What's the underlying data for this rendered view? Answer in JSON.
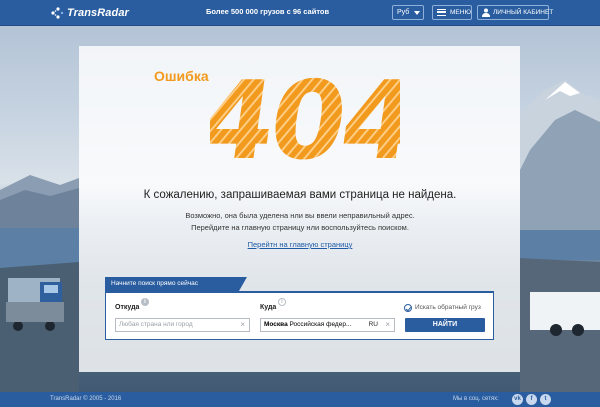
{
  "header": {
    "logo_text": "TransRadar",
    "tagline_prefix": "Более ",
    "tagline_count": "500 000",
    "tagline_mid": " грузов с ",
    "tagline_sites": "96",
    "tagline_suffix": " сайтов",
    "currency": "Руб",
    "menu_label": "МЕНЮ",
    "cabinet_label": "ЛИЧНЫЙ КАБИНЕТ"
  },
  "error": {
    "word": "Ошибка",
    "code": "404",
    "title": "К сожалению, запрашиваемая вами страница не найдена.",
    "line1": "Возможно, она была уделена нли вы ввели неправильный адрес.",
    "line2": "Перейдите на главную страницу нли воспользуйтесь поиском.",
    "home_link": "Перейтн на главную страницу"
  },
  "search": {
    "tab_label": "Начните поиск прямо сейчас",
    "from_label": "Откуда",
    "from_placeholder": "Любая страна нли город",
    "to_label": "Куда",
    "to_value_city": "Москва",
    "to_value_region": " Российская федер...",
    "to_value_code": "RU",
    "reverse_label": "Искать обратный груз",
    "find_button": "НАЙТИ",
    "clear_glyph": "×",
    "info_glyph": "i"
  },
  "footer": {
    "copyright": "TransRadar © 2005 - 2016",
    "social_text": "Мы в соц. сетях:",
    "social_vk": "vk",
    "social_fb": "f",
    "social_tw": "t"
  },
  "colors": {
    "brand_blue": "#2a5d9f",
    "accent_orange": "#f29a1d"
  },
  "icons": {
    "logo": "radar-dots-icon",
    "menu": "hamburger-icon",
    "cabinet": "user-icon",
    "currency": "caret-down-icon",
    "info": "info-icon",
    "clear": "close-icon",
    "check": "checkmark-icon"
  }
}
